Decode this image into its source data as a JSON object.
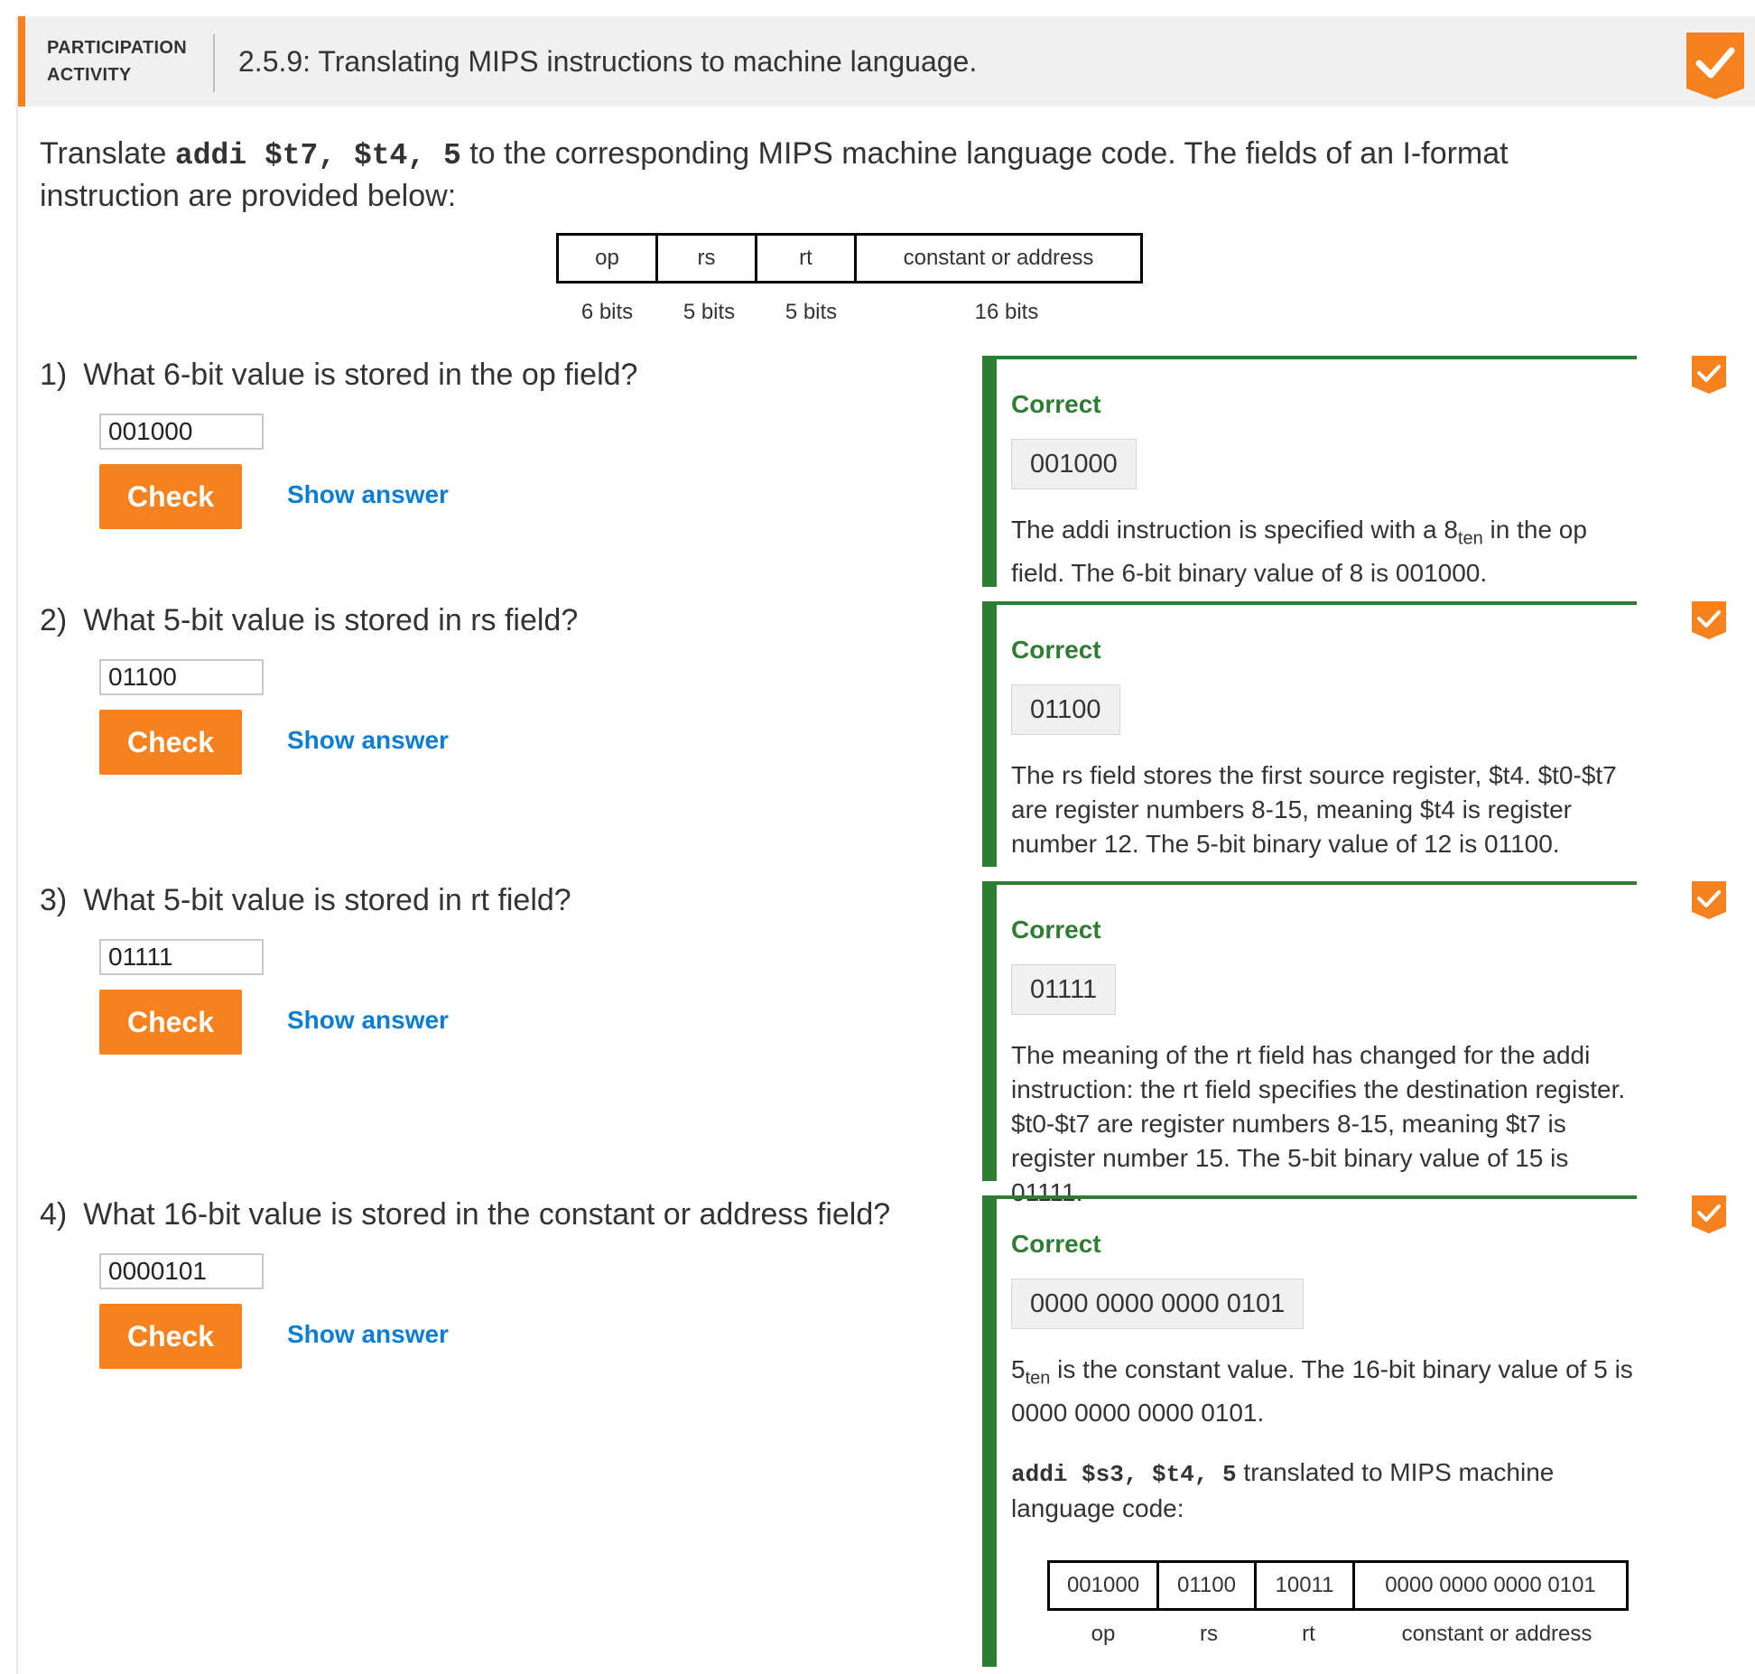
{
  "header": {
    "kind_label": "PARTICIPATION ACTIVITY",
    "title": "2.5.9: Translating MIPS instructions to machine language."
  },
  "intro": {
    "prefix": "Translate ",
    "code": "addi $t7, $t4, 5",
    "suffix": " to the corresponding MIPS machine language code. The fields of an I-format instruction are provided below:"
  },
  "format": {
    "fields": [
      "op",
      "rs",
      "rt",
      "constant or address"
    ],
    "bits": [
      "6 bits",
      "5 bits",
      "5 bits",
      "16 bits"
    ]
  },
  "controls": {
    "check_label": "Check",
    "show_answer_label": "Show answer"
  },
  "questions": [
    {
      "num": "1)",
      "text": "What 6-bit value is stored in the op field?",
      "input_value": "001000",
      "feedback": {
        "status": "Correct",
        "answer": "001000",
        "expl_a": "The addi instruction is specified with a 8",
        "expl_sub": "ten",
        "expl_b": " in the op field. The 6-bit binary value of 8 is 001000."
      }
    },
    {
      "num": "2)",
      "text": "What 5-bit value is stored in rs field?",
      "input_value": "01100",
      "feedback": {
        "status": "Correct",
        "answer": "01100",
        "expl": "The rs field stores the first source register, $t4. $t0-$t7 are register numbers 8-15, meaning $t4 is register number 12. The 5-bit binary value of 12 is 01100."
      }
    },
    {
      "num": "3)",
      "text": "What 5-bit value is stored in rt field?",
      "input_value": "01111",
      "feedback": {
        "status": "Correct",
        "answer": "01111",
        "expl": "The meaning of the rt field has changed for the addi instruction: the rt field specifies the destination register. $t0-$t7 are register numbers 8-15, meaning $t7 is register number 15. The 5-bit binary value of 15 is 01111."
      }
    },
    {
      "num": "4)",
      "text": "What 16-bit value is stored in the constant or address field?",
      "input_value": "0000101",
      "feedback": {
        "status": "Correct",
        "answer": "0000 0000 0000 0101",
        "expl_a": "5",
        "expl_sub": "ten",
        "expl_b": " is the constant value. The 16-bit binary value of 5 is 0000 0000 0000 0101.",
        "summary_code": "addi $s3, $t4, 5",
        "summary_text": " translated to MIPS machine language code:",
        "machine": {
          "values": [
            "001000",
            "01100",
            "10011",
            "0000 0000 0000 0101"
          ],
          "labels": [
            "op",
            "rs",
            "rt",
            "constant or address"
          ]
        }
      }
    }
  ],
  "colors": {
    "accent": "#f5821f",
    "correct": "#2f7d32",
    "link": "#0a7ed4"
  }
}
